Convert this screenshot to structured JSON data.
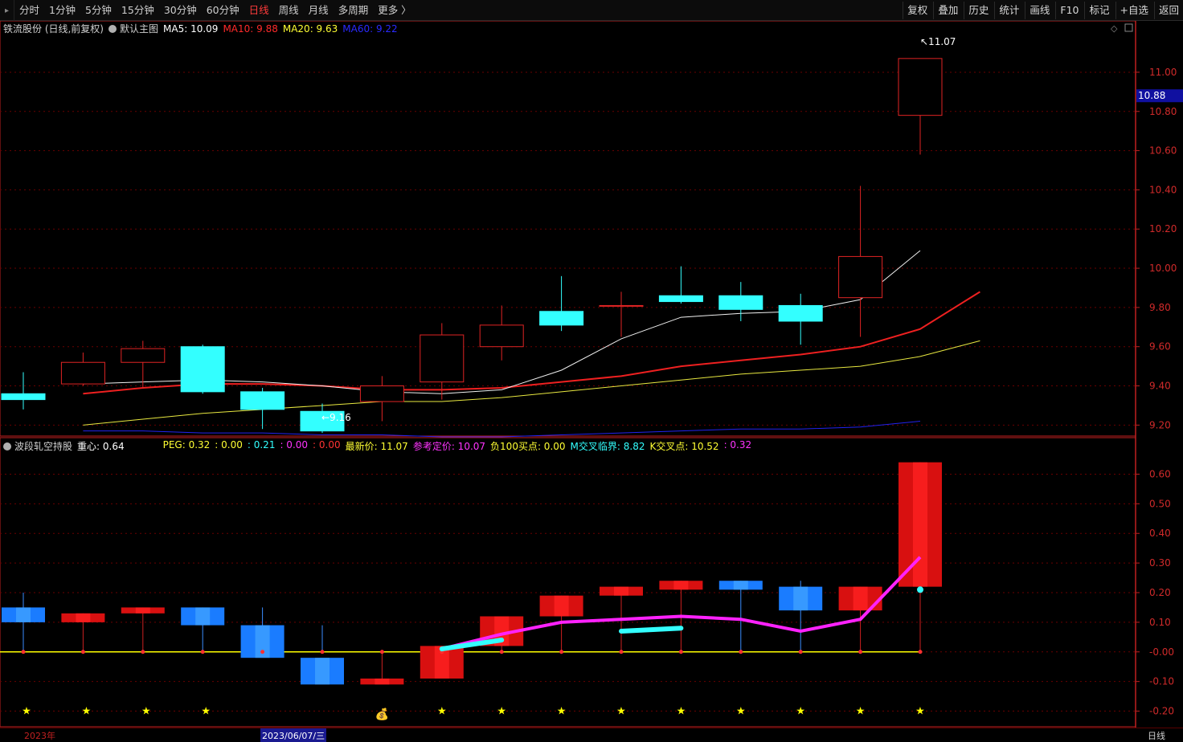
{
  "toolbar": {
    "periods": [
      "分时",
      "1分钟",
      "5分钟",
      "15分钟",
      "30分钟",
      "60分钟",
      "日线",
      "周线",
      "月线",
      "多周期",
      "更多 〉"
    ],
    "active_period": "日线",
    "tools": [
      "复权",
      "叠加",
      "历史",
      "统计",
      "画线",
      "F10",
      "标记",
      "+自选",
      "返回"
    ]
  },
  "main_panel": {
    "stock": "铁流股份 (日线,前复权)",
    "indicator": "默认主图",
    "ma": [
      {
        "label": "MA5: 10.09",
        "color": "#ffffff"
      },
      {
        "label": "MA10: 9.88",
        "color": "#ff2a2a"
      },
      {
        "label": "MA20: 9.63",
        "color": "#ffff33"
      },
      {
        "label": "MA60: 9.22",
        "color": "#2a2aff"
      }
    ],
    "y_ticks": [
      "11.00",
      "10.80",
      "10.60",
      "10.40",
      "10.20",
      "10.00",
      "9.80",
      "9.60",
      "9.40",
      "9.20"
    ],
    "current_price": "10.88",
    "high_label": "11.07",
    "low_label": "9.16"
  },
  "sub_panel": {
    "title": "波段轧空持股",
    "center": "重心: 0.64",
    "items": [
      {
        "text": "PEG: 0.32",
        "color": "#ffff33"
      },
      {
        "text": ": 0.00",
        "color": "#ffff33"
      },
      {
        "text": ": 0.21",
        "color": "#33ffff"
      },
      {
        "text": ": 0.00",
        "color": "#ff33ff"
      },
      {
        "text": ": 0.00",
        "color": "#ff3333"
      },
      {
        "text": "最新价: 11.07",
        "color": "#ffff33"
      },
      {
        "text": "参考定价: 10.07",
        "color": "#ff33ff"
      },
      {
        "text": "负100买点: 0.00",
        "color": "#ffff33"
      },
      {
        "text": "M交叉临界: 8.82",
        "color": "#33ffff"
      },
      {
        "text": "K交叉点: 10.52",
        "color": "#ffff33"
      },
      {
        "text": ": 0.32",
        "color": "#ff33ff"
      }
    ],
    "y_ticks": [
      "0.60",
      "0.50",
      "0.40",
      "0.30",
      "0.20",
      "0.10",
      "-0.00",
      "-0.10",
      "-0.20"
    ]
  },
  "bottom": {
    "year": "2023年",
    "cursor_date": "2023/06/07/三",
    "period": "日线"
  },
  "chart_data": {
    "type": "candlestick",
    "main": {
      "ylim": [
        9.14,
        11.18
      ],
      "candles": [
        {
          "o": 9.36,
          "h": 9.47,
          "l": 9.28,
          "c": 9.33
        },
        {
          "o": 9.41,
          "h": 9.57,
          "l": 9.4,
          "c": 9.52
        },
        {
          "o": 9.52,
          "h": 9.63,
          "l": 9.39,
          "c": 9.59
        },
        {
          "o": 9.6,
          "h": 9.61,
          "l": 9.36,
          "c": 9.37
        },
        {
          "o": 9.37,
          "h": 9.39,
          "l": 9.18,
          "c": 9.28
        },
        {
          "o": 9.27,
          "h": 9.31,
          "l": 9.16,
          "c": 9.17
        },
        {
          "o": 9.32,
          "h": 9.45,
          "l": 9.22,
          "c": 9.4
        },
        {
          "o": 9.42,
          "h": 9.72,
          "l": 9.33,
          "c": 9.66
        },
        {
          "o": 9.6,
          "h": 9.81,
          "l": 9.53,
          "c": 9.71
        },
        {
          "o": 9.78,
          "h": 9.96,
          "l": 9.68,
          "c": 9.71
        },
        {
          "o": 9.81,
          "h": 9.88,
          "l": 9.65,
          "c": 9.81
        },
        {
          "o": 9.86,
          "h": 10.01,
          "l": 9.82,
          "c": 9.83
        },
        {
          "o": 9.86,
          "h": 9.93,
          "l": 9.73,
          "c": 9.79
        },
        {
          "o": 9.81,
          "h": 9.87,
          "l": 9.61,
          "c": 9.73
        },
        {
          "o": 9.85,
          "h": 10.42,
          "l": 9.65,
          "c": 10.06
        },
        {
          "o": 10.78,
          "h": 11.07,
          "l": 10.58,
          "c": 11.07
        }
      ],
      "ma5": [
        null,
        9.41,
        9.42,
        9.43,
        9.42,
        9.4,
        9.37,
        9.36,
        9.38,
        9.48,
        9.64,
        9.75,
        9.77,
        9.78,
        9.84,
        10.09
      ],
      "ma10": [
        null,
        9.36,
        9.39,
        9.41,
        9.41,
        9.4,
        9.38,
        9.38,
        9.39,
        9.42,
        9.45,
        9.5,
        9.53,
        9.56,
        9.6,
        9.69,
        9.88
      ],
      "ma20": [
        null,
        9.2,
        9.23,
        9.26,
        9.28,
        9.3,
        9.32,
        9.32,
        9.34,
        9.37,
        9.4,
        9.43,
        9.46,
        9.48,
        9.5,
        9.55,
        9.63
      ],
      "ma60": [
        null,
        9.17,
        9.17,
        9.16,
        9.16,
        9.15,
        9.15,
        9.14,
        9.14,
        9.15,
        9.16,
        9.17,
        9.18,
        9.18,
        9.19,
        9.22
      ]
    },
    "sub": {
      "ylim": [
        -0.25,
        0.65
      ],
      "bars": [
        {
          "t": 0.15,
          "b": 0.1,
          "color": "blue",
          "wick": 0.2
        },
        {
          "t": 0.13,
          "b": 0.1,
          "color": "red",
          "wick": 0.13
        },
        {
          "t": 0.15,
          "b": 0.13,
          "color": "red",
          "wick": 0.15
        },
        {
          "t": 0.15,
          "b": 0.09,
          "color": "blue",
          "wick": 0.15
        },
        {
          "t": 0.09,
          "b": -0.02,
          "color": "blue",
          "wick": 0.15
        },
        {
          "t": -0.02,
          "b": -0.11,
          "color": "blue",
          "wick": 0.09
        },
        {
          "t": -0.09,
          "b": -0.11,
          "color": "red",
          "wick": -0.09
        },
        {
          "t": 0.02,
          "b": -0.09,
          "color": "red",
          "wick": 0.02
        },
        {
          "t": 0.12,
          "b": 0.02,
          "color": "red",
          "wick": 0.12
        },
        {
          "t": 0.19,
          "b": 0.12,
          "color": "red",
          "wick": 0.19
        },
        {
          "t": 0.22,
          "b": 0.19,
          "color": "red",
          "wick": 0.22
        },
        {
          "t": 0.24,
          "b": 0.21,
          "color": "red",
          "wick": 0.24
        },
        {
          "t": 0.24,
          "b": 0.21,
          "color": "blue",
          "wick": 0.24
        },
        {
          "t": 0.22,
          "b": 0.14,
          "color": "blue",
          "wick": 0.24
        },
        {
          "t": 0.22,
          "b": 0.14,
          "color": "red",
          "wick": 0.22
        },
        {
          "t": 0.64,
          "b": 0.22,
          "color": "red",
          "wick": 0.22
        }
      ],
      "magenta": [
        null,
        null,
        null,
        null,
        null,
        null,
        null,
        0.01,
        0.06,
        0.1,
        0.11,
        0.12,
        0.11,
        0.07,
        0.11,
        0.32
      ],
      "cyan_segments": [
        [
          7,
          0.01,
          8,
          0.04
        ],
        [
          10,
          0.07,
          11,
          0.08
        ]
      ],
      "yellow_stars": [
        0,
        1,
        2,
        3,
        7,
        8,
        9,
        10,
        11,
        12,
        13,
        14,
        15
      ],
      "red_stars": [
        2,
        7,
        8,
        9,
        10,
        11,
        12,
        13,
        14,
        15
      ],
      "money_bag_index": 6
    }
  },
  "colors": {
    "up": "#e02424",
    "down": "#33ffff",
    "grid": "#6a0000",
    "axis": "#c02020"
  }
}
